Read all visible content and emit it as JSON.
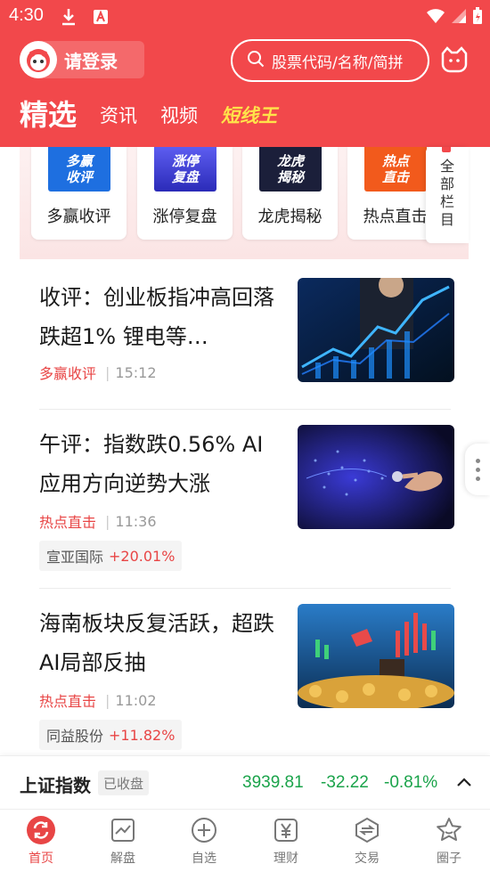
{
  "status_bar": {
    "time": "4:30"
  },
  "header": {
    "login_label": "请登录",
    "search_placeholder": "股票代码/名称/简拼",
    "tabs": [
      {
        "label": "精选",
        "active": true
      },
      {
        "label": "资讯"
      },
      {
        "label": "视频"
      },
      {
        "label": "短线王",
        "special": true
      }
    ]
  },
  "columns": {
    "items": [
      {
        "label": "多赢收评",
        "art": [
          "多赢",
          "收评"
        ],
        "color": "#1e6fe0"
      },
      {
        "label": "涨停复盘",
        "art": [
          "涨停",
          "复盘"
        ],
        "color": "#3b3bd6"
      },
      {
        "label": "龙虎揭秘",
        "art": [
          "龙虎",
          "揭秘"
        ],
        "color": "#1b1f3a"
      },
      {
        "label": "热点直击",
        "art": [
          "热点",
          "直击"
        ],
        "color": "#f25a1c"
      }
    ],
    "all_label": [
      "全",
      "部",
      "栏",
      "目"
    ]
  },
  "news": [
    {
      "title": "收评：创业板指冲高回落跌超1% 锂电等…",
      "source": "多赢收评",
      "time": "15:12"
    },
    {
      "title": "午评：指数跌0.56% AI应用方向逆势大涨",
      "source": "热点直击",
      "time": "11:36",
      "stock": {
        "name": "宣亚国际",
        "change": "+20.01%"
      }
    },
    {
      "title": "海南板块反复活跃，超跌AI局部反抽",
      "source": "热点直击",
      "time": "11:02",
      "stock": {
        "name": "同益股份",
        "change": "+11.82%"
      }
    }
  ],
  "index_bar": {
    "name": "上证指数",
    "status": "已收盘",
    "value": "3939.81",
    "change": "-32.22",
    "change_pct": "-0.81%"
  },
  "bottom_nav": [
    {
      "label": "首页",
      "icon": "home-refresh-icon",
      "active": true
    },
    {
      "label": "解盘",
      "icon": "chart-icon"
    },
    {
      "label": "自选",
      "icon": "plus-circle-icon"
    },
    {
      "label": "理财",
      "icon": "yen-icon"
    },
    {
      "label": "交易",
      "icon": "trade-icon"
    },
    {
      "label": "圈子",
      "icon": "star-icon"
    }
  ]
}
